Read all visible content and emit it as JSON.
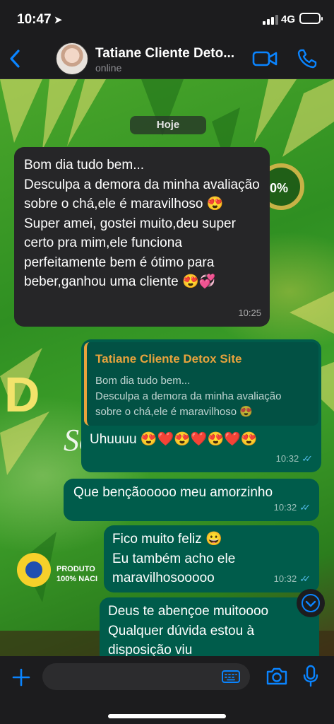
{
  "status_bar": {
    "time": "10:47",
    "network": "4G"
  },
  "header": {
    "contact_name": "Tatiane Cliente Deto...",
    "contact_status": "online",
    "icons": {
      "back": "chevron-left-icon",
      "video": "video-call-icon",
      "call": "phone-icon"
    }
  },
  "chat": {
    "day_label": "Hoje",
    "messages": [
      {
        "dir": "in",
        "text": "Bom dia tudo bem...\nDesculpa a demora da minha avaliação sobre o chá,ele é maravilhoso 😍\nSuper amei, gostei muito,deu super certo pra mim,ele funciona perfeitamente bem é ótimo para beber,ganhou uma cliente 😍💞",
        "time": "10:25"
      },
      {
        "dir": "out",
        "quote_name": "Tatiane Cliente Detox Site",
        "quote_text": "Bom dia tudo bem...\nDesculpa a demora da minha avaliação sobre o chá,ele é maravilhoso 😍",
        "text": "Uhuuuu 😍❤️😍❤️😍❤️😍",
        "time": "10:32"
      },
      {
        "dir": "out",
        "text": "Que bençãooooo meu amorzinho",
        "time": "10:32"
      },
      {
        "dir": "out",
        "text": "Fico muito feliz 😀\nEu também acho ele maravilhosooooo",
        "time": "10:32"
      },
      {
        "dir": "out",
        "text": "Deus te abençoe muitoooo\nQualquer dúvida estou à\ndisposição viu",
        "time": ""
      }
    ]
  },
  "composer": {
    "placeholder": ""
  },
  "colors": {
    "accent": "#0a84ff",
    "outgoing_bubble": "#005c4b",
    "incoming_bubble": "#262628",
    "read_ticks": "#53bdeb",
    "quote_bar": "#e8a33d"
  }
}
